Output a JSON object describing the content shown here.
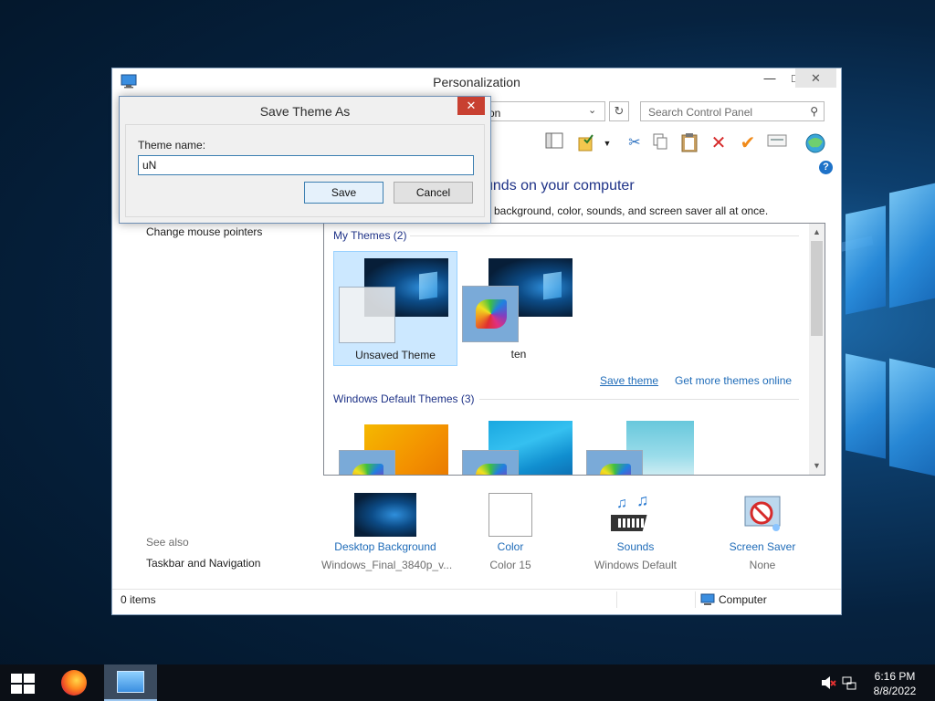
{
  "window": {
    "title": "Personalization",
    "address_text": "on",
    "search_placeholder": "Search Control Panel",
    "heading": "unds on your computer",
    "subheading": "p background, color, sounds, and screen saver all at once."
  },
  "sidebar": {
    "items": [
      {
        "label": "Change mouse pointers"
      }
    ],
    "see_also_label": "See also",
    "see_also_items": [
      {
        "label": "Taskbar and Navigation"
      }
    ]
  },
  "themes": {
    "my_themes_header": "My Themes (2)",
    "my_themes": [
      {
        "label": "Unsaved Theme",
        "selected": true
      },
      {
        "label": "ten",
        "selected": false
      }
    ],
    "save_theme_link": "Save theme",
    "get_more_link": "Get more themes online",
    "default_header": "Windows Default Themes (3)"
  },
  "bottom": [
    {
      "title": "Desktop Background",
      "subtitle": "Windows_Final_3840p_v..."
    },
    {
      "title": "Color",
      "subtitle": "Color 15"
    },
    {
      "title": "Sounds",
      "subtitle": "Windows Default"
    },
    {
      "title": "Screen Saver",
      "subtitle": "None"
    }
  ],
  "status": {
    "items_count": "0 items",
    "location": "Computer"
  },
  "dialog": {
    "title": "Save Theme As",
    "label": "Theme name:",
    "input_value": "uN",
    "save_label": "Save",
    "cancel_label": "Cancel"
  },
  "taskbar": {
    "time": "6:16 PM",
    "date": "8/8/2022"
  },
  "colors": {
    "accent_blue": "#1e6bb8",
    "heading_blue": "#1e3287",
    "close_red": "#c84031",
    "selected_bg": "#cce8ff"
  }
}
